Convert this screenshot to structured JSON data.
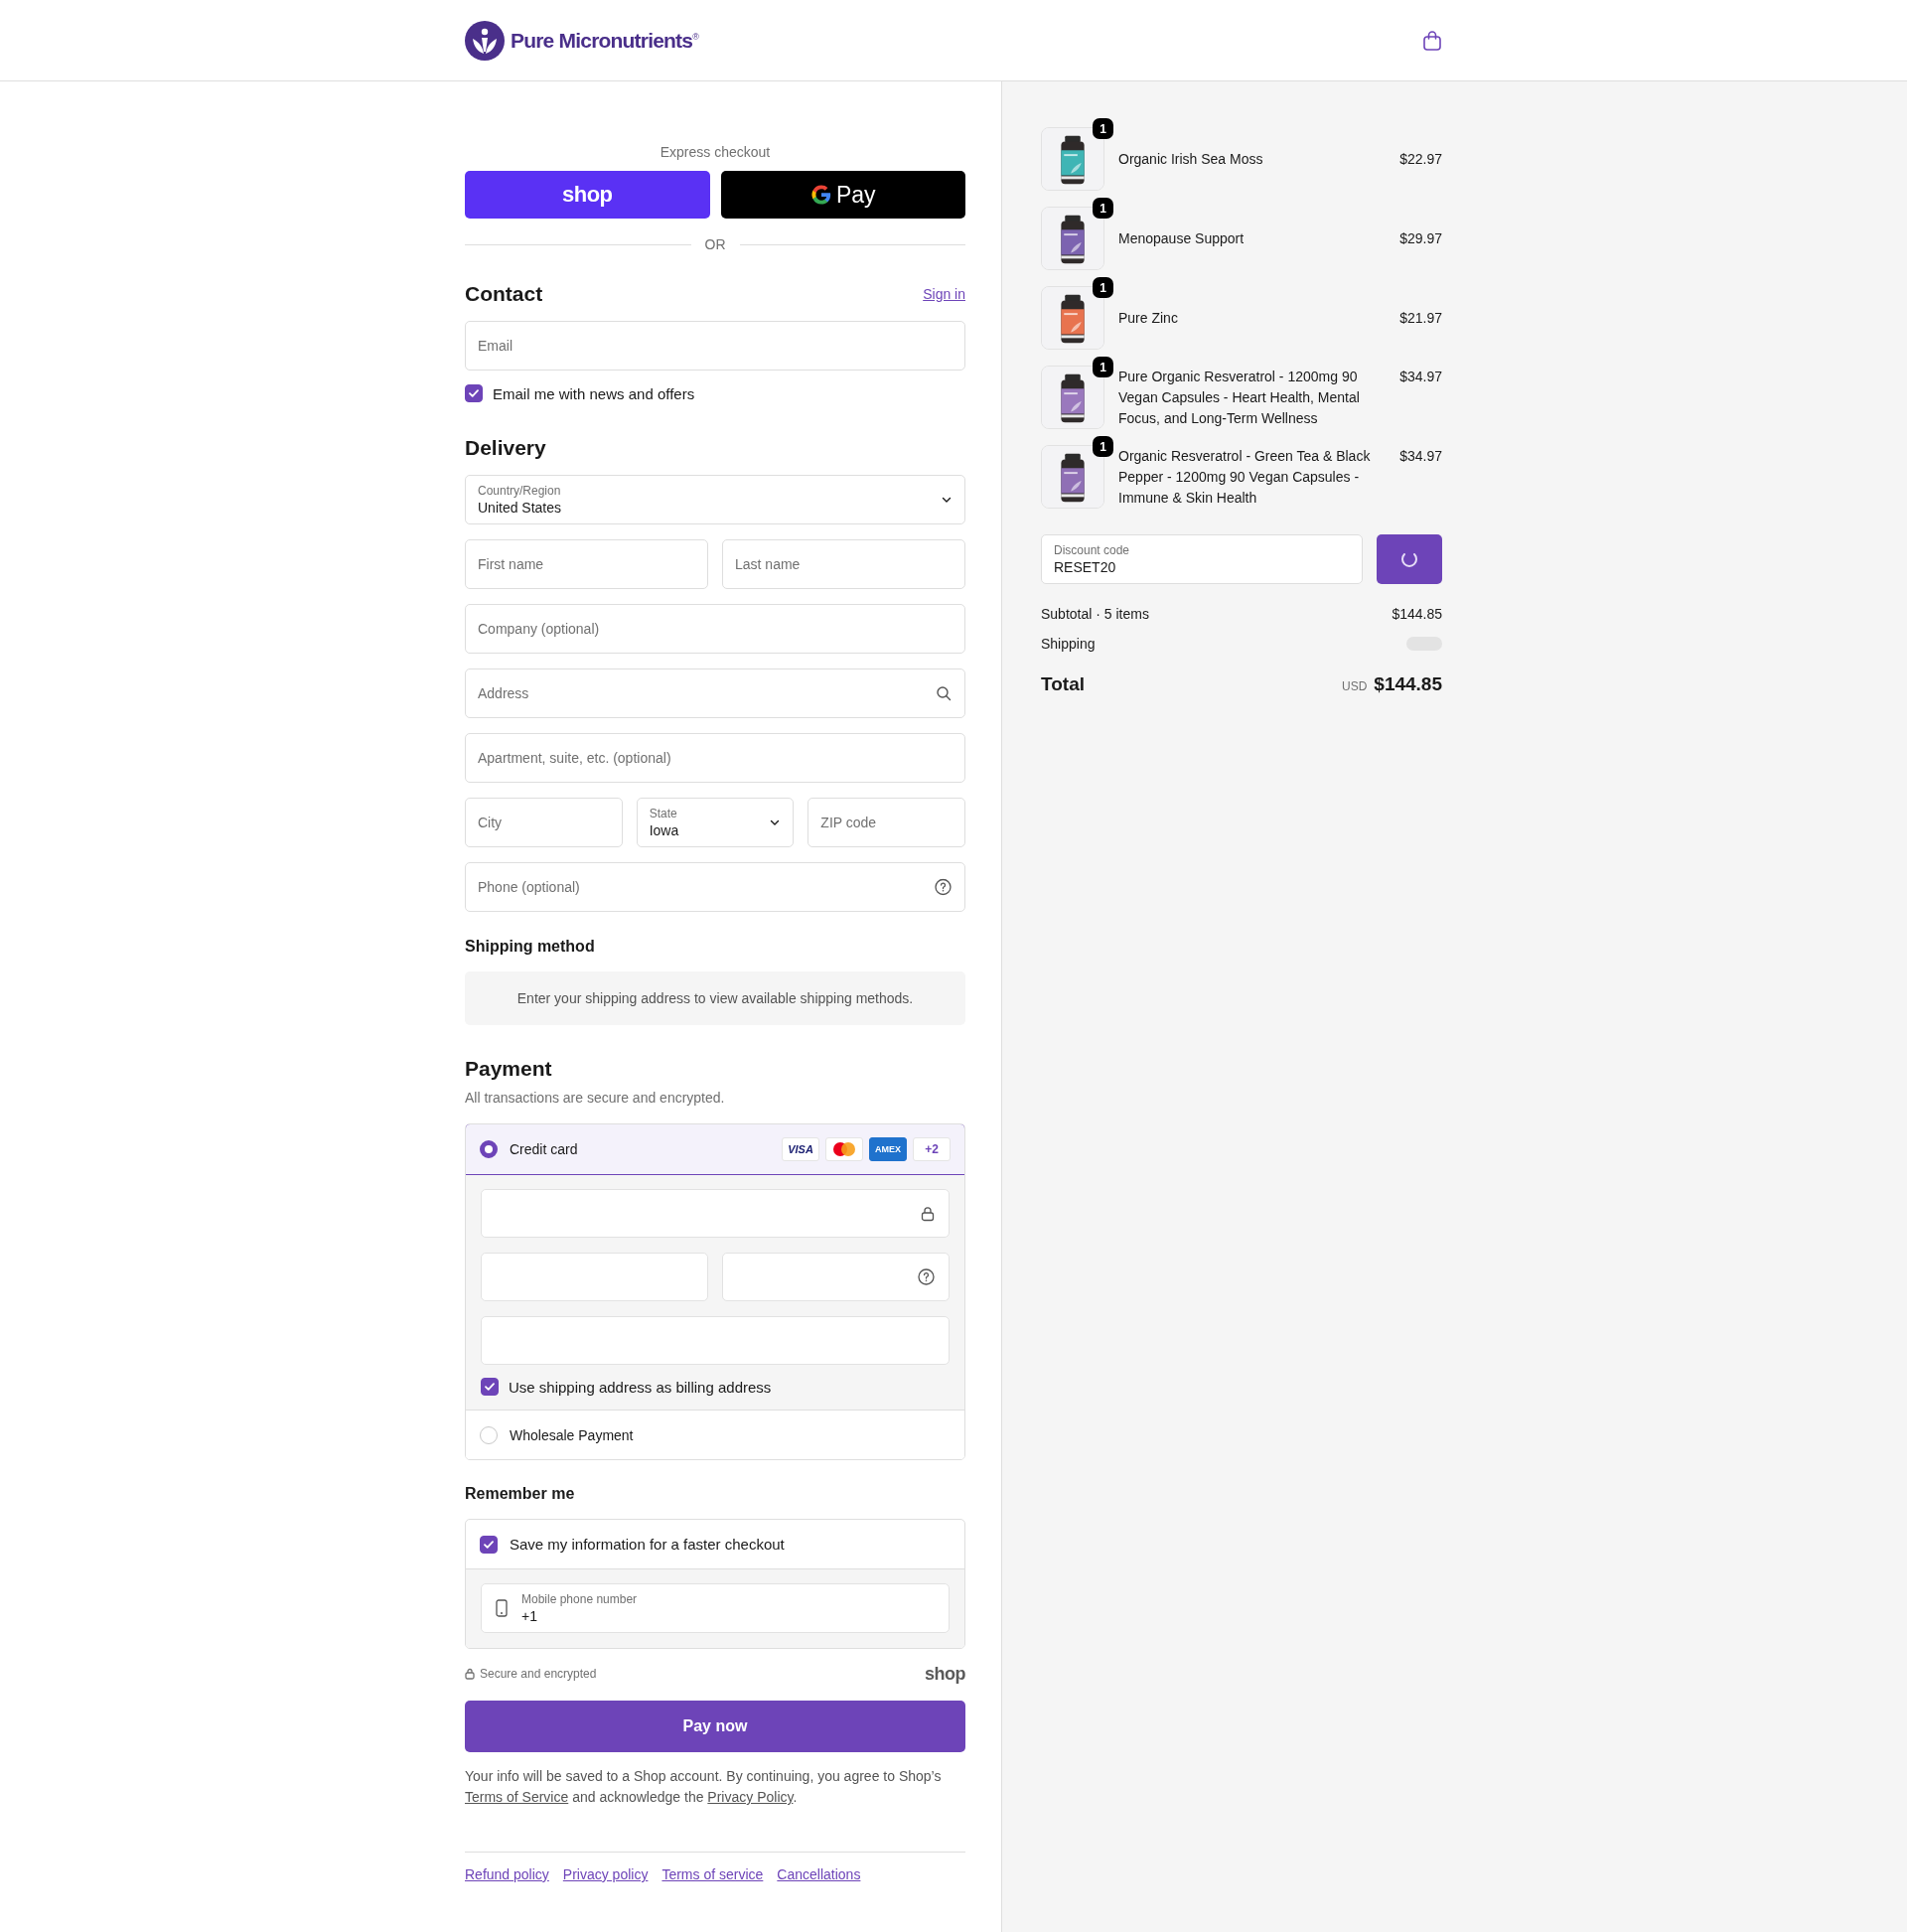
{
  "header": {
    "brand": "Pure Micronutrients$^{®}$"
  },
  "express_checkout": {
    "label": "Express checkout",
    "buttons": [
      {
        "kind": "shop",
        "label": "shop"
      },
      {
        "kind": "gpay",
        "label": "Pay"
      }
    ],
    "divider": "OR"
  },
  "contact": {
    "title": "Contact",
    "sign_in": "Sign in",
    "email": {
      "placeholder": "Email"
    },
    "newsletter": {
      "label": "Email me with news and offers",
      "checked": true
    }
  },
  "delivery": {
    "title": "Delivery",
    "rows": [
      [
        {
          "kind": "select",
          "label": "Country/Region",
          "value": "United States"
        }
      ],
      [
        {
          "kind": "text",
          "placeholder": "First name"
        },
        {
          "kind": "text",
          "placeholder": "Last name"
        }
      ],
      [
        {
          "kind": "text",
          "placeholder": "Company (optional)"
        }
      ],
      [
        {
          "kind": "search",
          "placeholder": "Address"
        }
      ],
      [
        {
          "kind": "text",
          "placeholder": "Apartment, suite, etc. (optional)"
        }
      ],
      [
        {
          "kind": "text",
          "placeholder": "City"
        },
        {
          "kind": "select",
          "label": "State",
          "value": "Iowa"
        },
        {
          "kind": "text",
          "placeholder": "ZIP code"
        }
      ],
      [
        {
          "kind": "help",
          "placeholder": "Phone (optional)"
        }
      ]
    ]
  },
  "shipping_method": {
    "title": "Shipping method",
    "notice": "Enter your shipping address to view available shipping methods."
  },
  "payment": {
    "title": "Payment",
    "subtitle": "All transactions are secure and encrypted.",
    "methods": [
      {
        "label": "Credit card",
        "selected": true,
        "cards": [
          {
            "kind": "visa",
            "label": "VISA"
          },
          {
            "kind": "mastercard"
          },
          {
            "kind": "amex",
            "label": "AMEX"
          },
          {
            "kind": "more",
            "label": "+2"
          }
        ],
        "billing": {
          "label": "Use shipping address as billing address",
          "checked": true
        }
      },
      {
        "label": "Wholesale Payment",
        "selected": false
      }
    ]
  },
  "remember_me": {
    "title": "Remember me",
    "save": {
      "label": "Save my information for a faster checkout",
      "checked": true
    },
    "phone": {
      "label": "Mobile phone number",
      "value": "+1"
    }
  },
  "secure_note": "Secure and encrypted",
  "shop_logo": "shop",
  "pay_button": "Pay now",
  "legal": [
    {
      "kind": "text",
      "text": "Your info will be saved to a Shop account. By continuing, you agree to Shop’s "
    },
    {
      "kind": "link",
      "text": "Terms of Service"
    },
    {
      "kind": "text",
      "text": " and acknowledge the "
    },
    {
      "kind": "link",
      "text": "Privacy Policy"
    },
    {
      "kind": "text",
      "text": "."
    }
  ],
  "footer_links": [
    "Refund policy",
    "Privacy policy",
    "Terms of service",
    "Cancellations"
  ],
  "order": {
    "items": [
      {
        "name": "Organic Irish Sea Moss",
        "price": "$22.97",
        "quantity": "1"
      },
      {
        "name": "Menopause Support",
        "price": "$29.97",
        "quantity": "1"
      },
      {
        "name": "Pure Zinc",
        "price": "$21.97",
        "quantity": "1"
      },
      {
        "name": "Pure Organic Resveratrol - 1200mg 90 Vegan Capsules - Heart Health, Mental Focus, and Long-Term Wellness",
        "price": "$34.97",
        "quantity": "1"
      },
      {
        "name": "Organic Resveratrol - Green Tea & Black Pepper - 1200mg 90 Vegan Capsules - Immune & Skin Health",
        "price": "$34.97",
        "quantity": "1"
      }
    ],
    "discount": {
      "label": "Discount code",
      "value": "RESET20"
    },
    "subtotal": {
      "label": "Subtotal · 5 items",
      "value": "$144.85"
    },
    "shipping": {
      "label": "Shipping"
    },
    "total": {
      "label": "Total",
      "currency": "USD",
      "value": "$144.85"
    }
  }
}
